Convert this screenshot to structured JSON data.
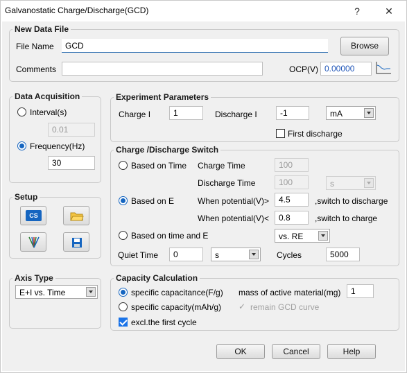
{
  "window": {
    "title": "Galvanostatic Charge/Discharge(GCD)",
    "help_glyph": "?",
    "close_glyph": "✕"
  },
  "new_data_file": {
    "legend": "New Data File",
    "file_name_label": "File Name",
    "file_name_value": "GCD",
    "browse_label": "Browse",
    "comments_label": "Comments",
    "comments_value": "",
    "ocp_label": "OCP(V)",
    "ocp_value": "0.00000"
  },
  "data_acquisition": {
    "legend": "Data Acquisition",
    "interval_label": "Interval(s)",
    "interval_value": "0.01",
    "frequency_label": "Frequency(Hz)",
    "frequency_value": "30",
    "selected": "frequency"
  },
  "setup": {
    "legend": "Setup",
    "cs_icon_text": "CS"
  },
  "axis_type": {
    "legend": "Axis Type",
    "value": "E+I vs. Time"
  },
  "experiment_parameters": {
    "legend": "Experiment Parameters",
    "charge_label": "Charge I",
    "charge_value": "1",
    "discharge_label": "Discharge I",
    "discharge_value": "-1",
    "unit_value": "mA",
    "first_discharge_label": "First discharge",
    "first_discharge_checked": false
  },
  "switch": {
    "legend": "Charge /Discharge Switch",
    "based_time_label": "Based on Time",
    "charge_time_label": "Charge Time",
    "charge_time_value": "100",
    "discharge_time_label": "Discharge Time",
    "discharge_time_value": "100",
    "time_unit_value": "s",
    "based_e_label": "Based on E",
    "when_gt_label": "When potential(V)>",
    "when_gt_value": "4.5",
    "switch_discharge_label": ",switch to discharge",
    "when_lt_label": "When potential(V)<",
    "when_lt_value": "0.8",
    "switch_charge_label": ",switch to charge",
    "based_time_e_label": "Based on time and E",
    "ref_value": "vs. RE",
    "quiet_time_label": "Quiet Time",
    "quiet_time_value": "0",
    "quiet_unit_value": "s",
    "cycles_label": "Cycles",
    "cycles_value": "5000",
    "selected": "based_e"
  },
  "capacity": {
    "legend": "Capacity Calculation",
    "spec_capacitance_label": "specific capacitance(F/g)",
    "mass_label": "mass of active material(mg)",
    "mass_value": "1",
    "spec_capacity_label": "specific capacity(mAh/g)",
    "remain_label": "remain GCD curve",
    "excl_label": "excl.the first cycle",
    "excl_checked": true,
    "selected": "capacitance"
  },
  "buttons": {
    "ok": "OK",
    "cancel": "Cancel",
    "help": "Help"
  },
  "colors": {
    "accent": "#1565c0",
    "background": "#f0f0f0",
    "ocp_value": "#1f55b8"
  }
}
